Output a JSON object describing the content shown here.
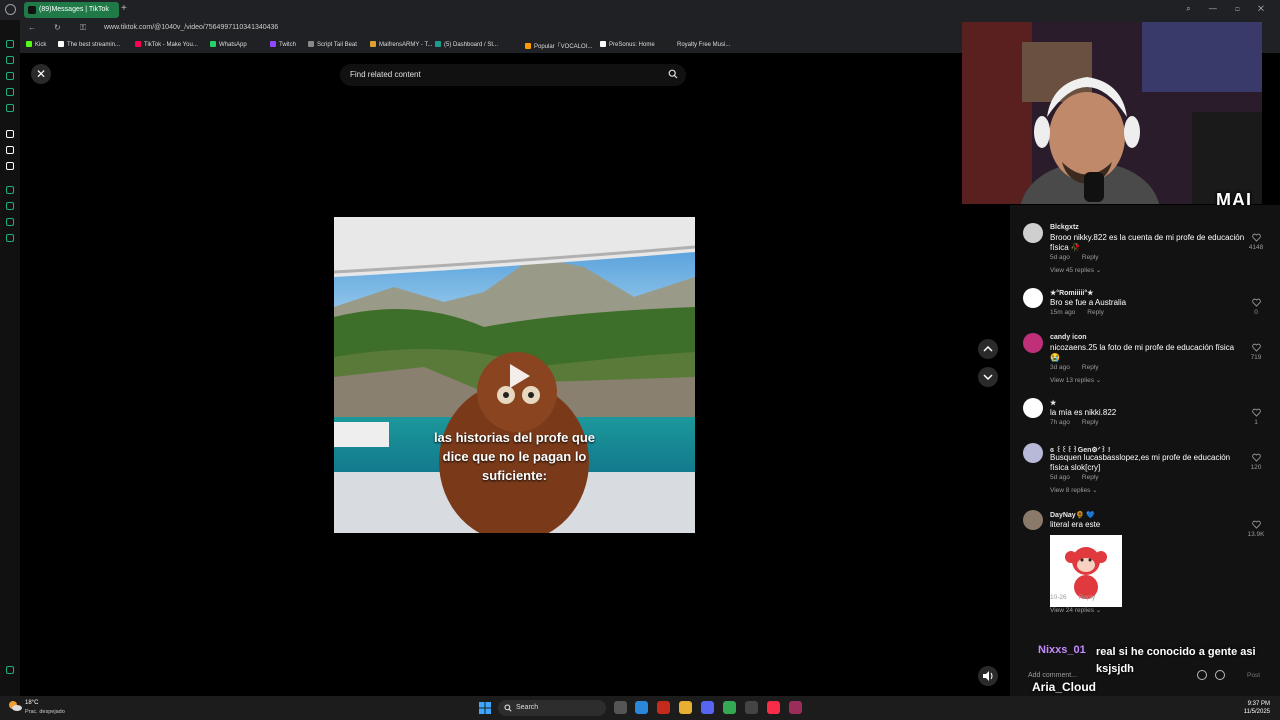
{
  "browser": {
    "tab_title": "(89)Messages | TikTok",
    "url": "www.tiktok.com/@1040v_/video/7564997110341340436",
    "bookmarks": [
      {
        "label": "Kick",
        "color": "#53fc18"
      },
      {
        "label": "The best streamin...",
        "color": "#ffffff"
      },
      {
        "label": "TikTok - Make You...",
        "color": "#ff0050"
      },
      {
        "label": "WhatsApp",
        "color": "#25d366"
      },
      {
        "label": "Twitch",
        "color": "#9146ff"
      },
      {
        "label": "Script Tail Beat",
        "color": "#888888"
      },
      {
        "label": "MaifrensARMY - T...",
        "color": "#e0a030"
      },
      {
        "label": "(5) Dashboard / St...",
        "color": "#1a9b8c"
      },
      {
        "label": "Popular「VOCALOI...",
        "color": "#ff9900"
      },
      {
        "label": "PreSonus: Home",
        "color": "#ffffff"
      },
      {
        "label": "Royalty Free Musi...",
        "color": "#222222"
      }
    ]
  },
  "overlay": {
    "close_label": "✕",
    "search_placeholder": "Find related content",
    "caption_lines": [
      "las historias del profe que",
      "dice que no le pagan lo",
      "suficiente:"
    ]
  },
  "comments": [
    {
      "user": "Blckgxtz",
      "text": "Brooo nikky.822 es la cuenta de mi profe de educación física 🥀",
      "age": "5d ago",
      "reply": "Reply",
      "likes": "4148",
      "view_replies": "View 45 replies",
      "avatar_color": "#cfcfcf"
    },
    {
      "user": "★°Romiiiii°★",
      "text": "Bro se fue a Australia",
      "age": "15m ago",
      "reply": "Reply",
      "likes": "0",
      "view_replies": "",
      "avatar_color": "#ffffff"
    },
    {
      "user": "candy icon",
      "text": "nicozaens.25 la foto de mi profe de educación física 😭",
      "age": "3d ago",
      "reply": "Reply",
      "likes": "719",
      "view_replies": "View 13 replies",
      "avatar_color": "#c0307a"
    },
    {
      "user": "★",
      "text": "la mía es nikki.822",
      "age": "7h ago",
      "reply": "Reply",
      "likes": "1",
      "view_replies": "",
      "avatar_color": "#ffffff"
    },
    {
      "user": "ɞ ꒰꒰꒰꒱Gen⚙︎ᐟ꒱ !",
      "text": "Busquen lucasbasslopez,es mi profe de educación física slok[cry]",
      "age": "5d ago",
      "reply": "Reply",
      "likes": "120",
      "view_replies": "View 8 replies",
      "avatar_color": "#b8b8d8"
    },
    {
      "user": "DayNay🌻 💙",
      "text": "literal era este",
      "age": "10-26",
      "reply": "Reply",
      "likes": "13.9K",
      "view_replies": "View 24 replies",
      "avatar_color": "#8a7a6a"
    }
  ],
  "comment_box": {
    "placeholder": "Add comment...",
    "post_label": "Post"
  },
  "webcam": {
    "logo_text": "MAI"
  },
  "stream_chat": {
    "user1": "Nixxs_01",
    "message": "real si he conocido a gente asi ksjsjdh",
    "user2": "Aria_Cloud"
  },
  "taskbar": {
    "weather_temp": "18°C",
    "weather_desc": "Prac. despejado",
    "search_label": "Search",
    "time": "9:37 PM",
    "date": "11/5/2025"
  },
  "colors": {
    "accent": "#1f7a48",
    "panel": "#121212"
  }
}
